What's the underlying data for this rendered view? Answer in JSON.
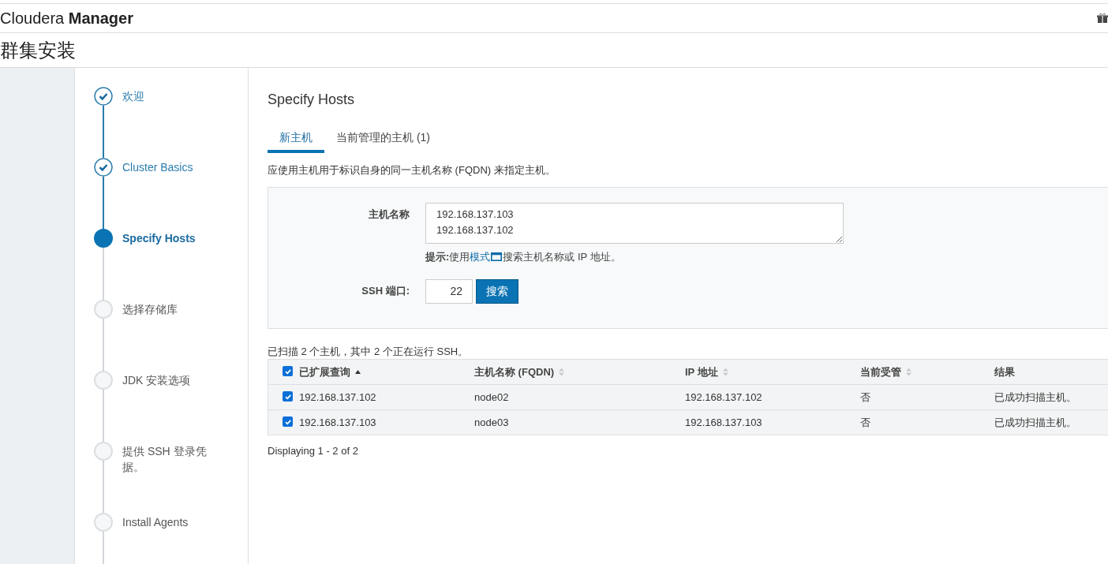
{
  "header": {
    "brand_light": "Cloudera",
    "brand_bold": "Manager"
  },
  "page_title": "群集安装",
  "steps": [
    {
      "label": "欢迎",
      "kind": "done"
    },
    {
      "label": "Cluster Basics",
      "kind": "done"
    },
    {
      "label": "Specify Hosts",
      "kind": "current"
    },
    {
      "label": "选择存储库",
      "kind": "todo"
    },
    {
      "label": "JDK 安装选项",
      "kind": "todo"
    },
    {
      "label": "提供 SSH 登录凭据。",
      "kind": "todo"
    },
    {
      "label": "Install Agents",
      "kind": "todo"
    }
  ],
  "section_title": "Specify Hosts",
  "tabs": [
    {
      "label": "新主机",
      "selected": true
    },
    {
      "label": "当前管理的主机 (1)",
      "selected": false
    }
  ],
  "description": "应使用主机用于标识自身的同一主机名称 (FQDN) 来指定主机。",
  "form": {
    "hostname_label": "主机名称",
    "hostname_value": "192.168.137.103\n192.168.137.102",
    "hint_prefix": "提示:",
    "hint_before": " 使用",
    "hint_link": "模式",
    "hint_after": "搜索主机名称或 IP 地址。",
    "ssh_label": "SSH 端口:",
    "ssh_value": "22",
    "search_button": "搜索"
  },
  "scan_summary": "已扫描 2 个主机，其中 2 个正在运行 SSH。",
  "table": {
    "all_checked": true,
    "columns": [
      {
        "label": "已扩展查询",
        "kind": "sorted"
      },
      {
        "label": "主机名称 (FQDN)",
        "kind": "sortable"
      },
      {
        "label": "IP 地址",
        "kind": "sortable"
      },
      {
        "label": "当前受管",
        "kind": "sortable"
      },
      {
        "label": "结果",
        "kind": "plain"
      }
    ],
    "rows": [
      {
        "checked": true,
        "cells": [
          "192.168.137.102",
          "node02",
          "192.168.137.102",
          "否",
          "已成功扫描主机。"
        ]
      },
      {
        "checked": true,
        "cells": [
          "192.168.137.103",
          "node03",
          "192.168.137.103",
          "否",
          "已成功扫描主机。"
        ]
      }
    ]
  },
  "pagination": "Displaying 1 - 2 of 2"
}
